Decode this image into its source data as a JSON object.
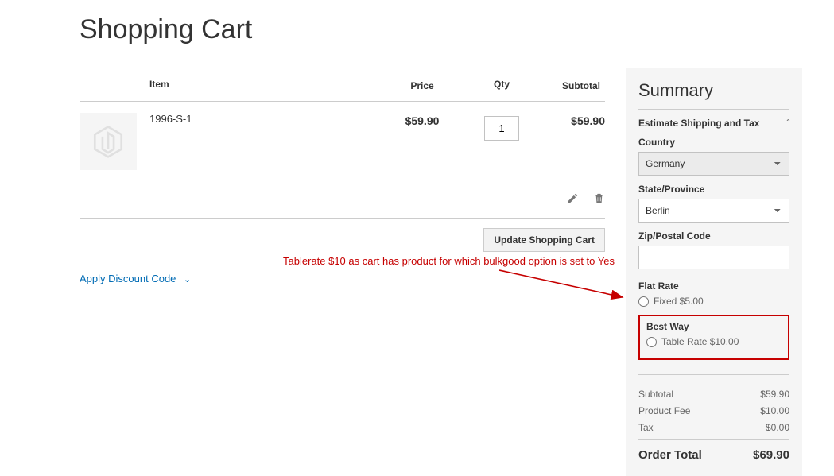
{
  "page": {
    "title": "Shopping Cart"
  },
  "table": {
    "headers": {
      "item": "Item",
      "price": "Price",
      "qty": "Qty",
      "subtotal": "Subtotal"
    },
    "item": {
      "name": "1996-S-1",
      "price": "$59.90",
      "qty": "1",
      "subtotal": "$59.90"
    }
  },
  "actions": {
    "update": "Update Shopping Cart"
  },
  "discount": {
    "label": "Apply Discount Code"
  },
  "summary": {
    "title": "Summary",
    "estimate_label": "Estimate Shipping and Tax",
    "country_label": "Country",
    "country_value": "Germany",
    "state_label": "State/Province",
    "state_value": "Berlin",
    "zip_label": "Zip/Postal Code",
    "zip_value": "",
    "flat_rate": {
      "title": "Flat Rate",
      "option": "Fixed $5.00"
    },
    "best_way": {
      "title": "Best Way",
      "option": "Table Rate $10.00"
    },
    "totals": {
      "subtotal_label": "Subtotal",
      "subtotal_value": "$59.90",
      "fee_label": "Product Fee",
      "fee_value": "$10.00",
      "tax_label": "Tax",
      "tax_value": "$0.00",
      "order_label": "Order Total",
      "order_value": "$69.90"
    }
  },
  "annotation": {
    "text": "Tablerate $10 as cart has product for which bulkgood option is set to Yes"
  }
}
